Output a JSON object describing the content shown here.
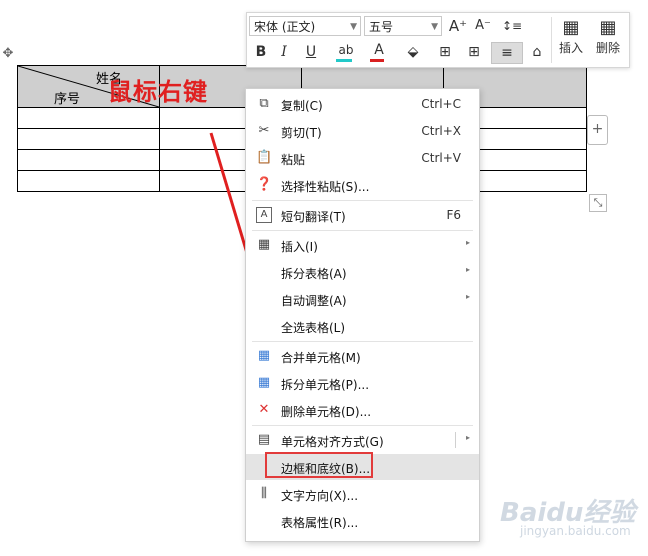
{
  "document": {
    "table": {
      "header_name": "姓名",
      "header_seq": "序号",
      "rows": 4
    },
    "annotation": "鼠标右键",
    "add_row_symbol": "+",
    "move_symbol": "✥",
    "resize_symbol": "⤡"
  },
  "toolbar": {
    "font_name": "宋体 (正文)",
    "font_size": "五号",
    "grow_font": "A⁺",
    "shrink_font": "A⁻",
    "line_spacing": "↕≡",
    "bold": "B",
    "italic": "I",
    "underline": "U",
    "highlight": "ab",
    "font_color": "A",
    "fill": "⬙",
    "borders": "⊞",
    "table_borders": "⊞",
    "align": "≡",
    "eraser": "⌂",
    "insert_label": "插入",
    "delete_label": "删除",
    "highlight_color": "#22c9c9",
    "font_color_value": "#d92020"
  },
  "context_menu": {
    "items": [
      {
        "icon": "⧉",
        "label": "复制(C)",
        "shortcut": "Ctrl+C"
      },
      {
        "icon": "✂",
        "label": "剪切(T)",
        "shortcut": "Ctrl+X"
      },
      {
        "icon": "📋",
        "label": "粘贴",
        "shortcut": "Ctrl+V"
      },
      {
        "icon": "❓",
        "label": "选择性粘贴(S)...",
        "shortcut": ""
      },
      {
        "icon": "A",
        "label": "短句翻译(T)",
        "shortcut": "F6"
      },
      {
        "icon": "▦",
        "label": "插入(I)",
        "shortcut": ""
      },
      {
        "icon": "",
        "label": "拆分表格(A)",
        "shortcut": ""
      },
      {
        "icon": "",
        "label": "自动调整(A)",
        "shortcut": ""
      },
      {
        "icon": "",
        "label": "全选表格(L)",
        "shortcut": ""
      },
      {
        "icon": "▦",
        "label": "合并单元格(M)",
        "shortcut": ""
      },
      {
        "icon": "▦",
        "label": "拆分单元格(P)...",
        "shortcut": ""
      },
      {
        "icon": "✕",
        "label": "删除单元格(D)...",
        "shortcut": ""
      },
      {
        "icon": "▤",
        "label": "单元格对齐方式(G)",
        "shortcut": ""
      },
      {
        "icon": "",
        "label": "边框和底纹(B)...",
        "shortcut": ""
      },
      {
        "icon": "⫼",
        "label": "文字方向(X)...",
        "shortcut": ""
      },
      {
        "icon": "",
        "label": "表格属性(R)...",
        "shortcut": ""
      }
    ],
    "submenu_arrow": "▸"
  },
  "watermark": {
    "brand": "Baidu经验",
    "url": "jingyan.baidu.com"
  },
  "colors": {
    "annotation_red": "#e02020",
    "header_fill": "#cfcfcf",
    "highlight_row": "#e4e4e4"
  }
}
